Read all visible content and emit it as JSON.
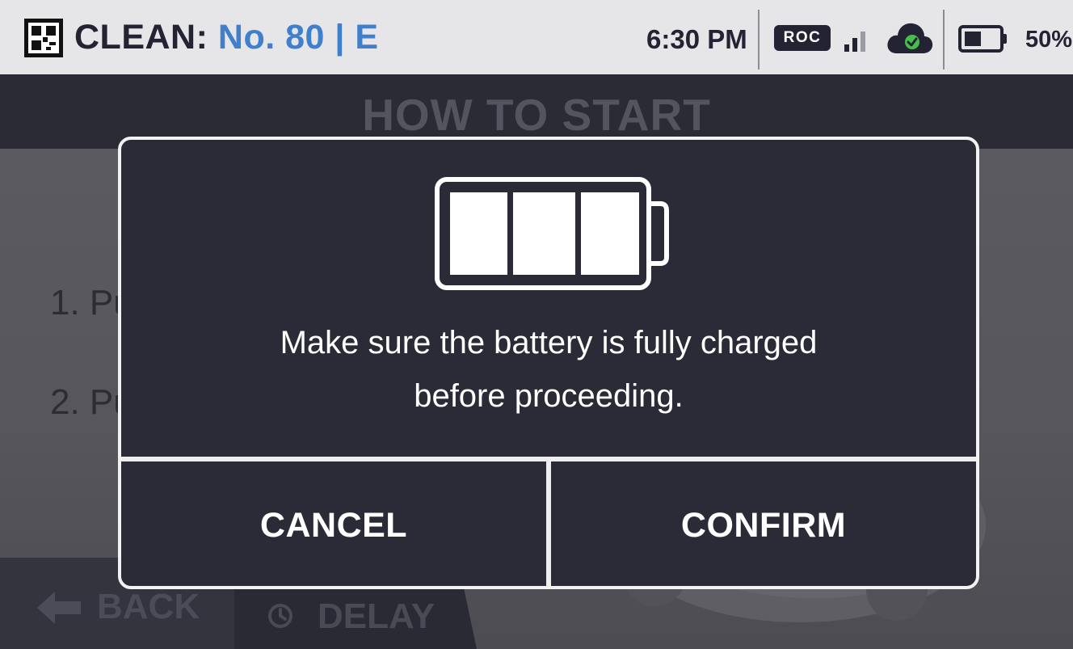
{
  "status_bar": {
    "mode_label": "CLEAN:",
    "machine_label": "No. 80 | E",
    "time": "6:30 PM",
    "roc_badge": "ROC",
    "battery_percent": "50%",
    "battery_level": 0.5,
    "signal_icon": "signal-strength-icon",
    "cloud_icon": "cloud-check-icon",
    "qr_icon": "qr-code-icon",
    "accent_color": "#3f7fcc",
    "cloud_color": "#232334",
    "check_color": "#44c04a"
  },
  "background": {
    "title": "HOW TO START",
    "steps": [
      "1. Push the handle down",
      "2. Push the blue button"
    ],
    "back_label": "BACK",
    "delay_label": "DELAY"
  },
  "modal": {
    "icon": "battery-full-icon",
    "message_line1": "Make sure the battery is fully charged",
    "message_line2": "before proceeding.",
    "cancel_label": "CANCEL",
    "confirm_label": "CONFIRM"
  }
}
